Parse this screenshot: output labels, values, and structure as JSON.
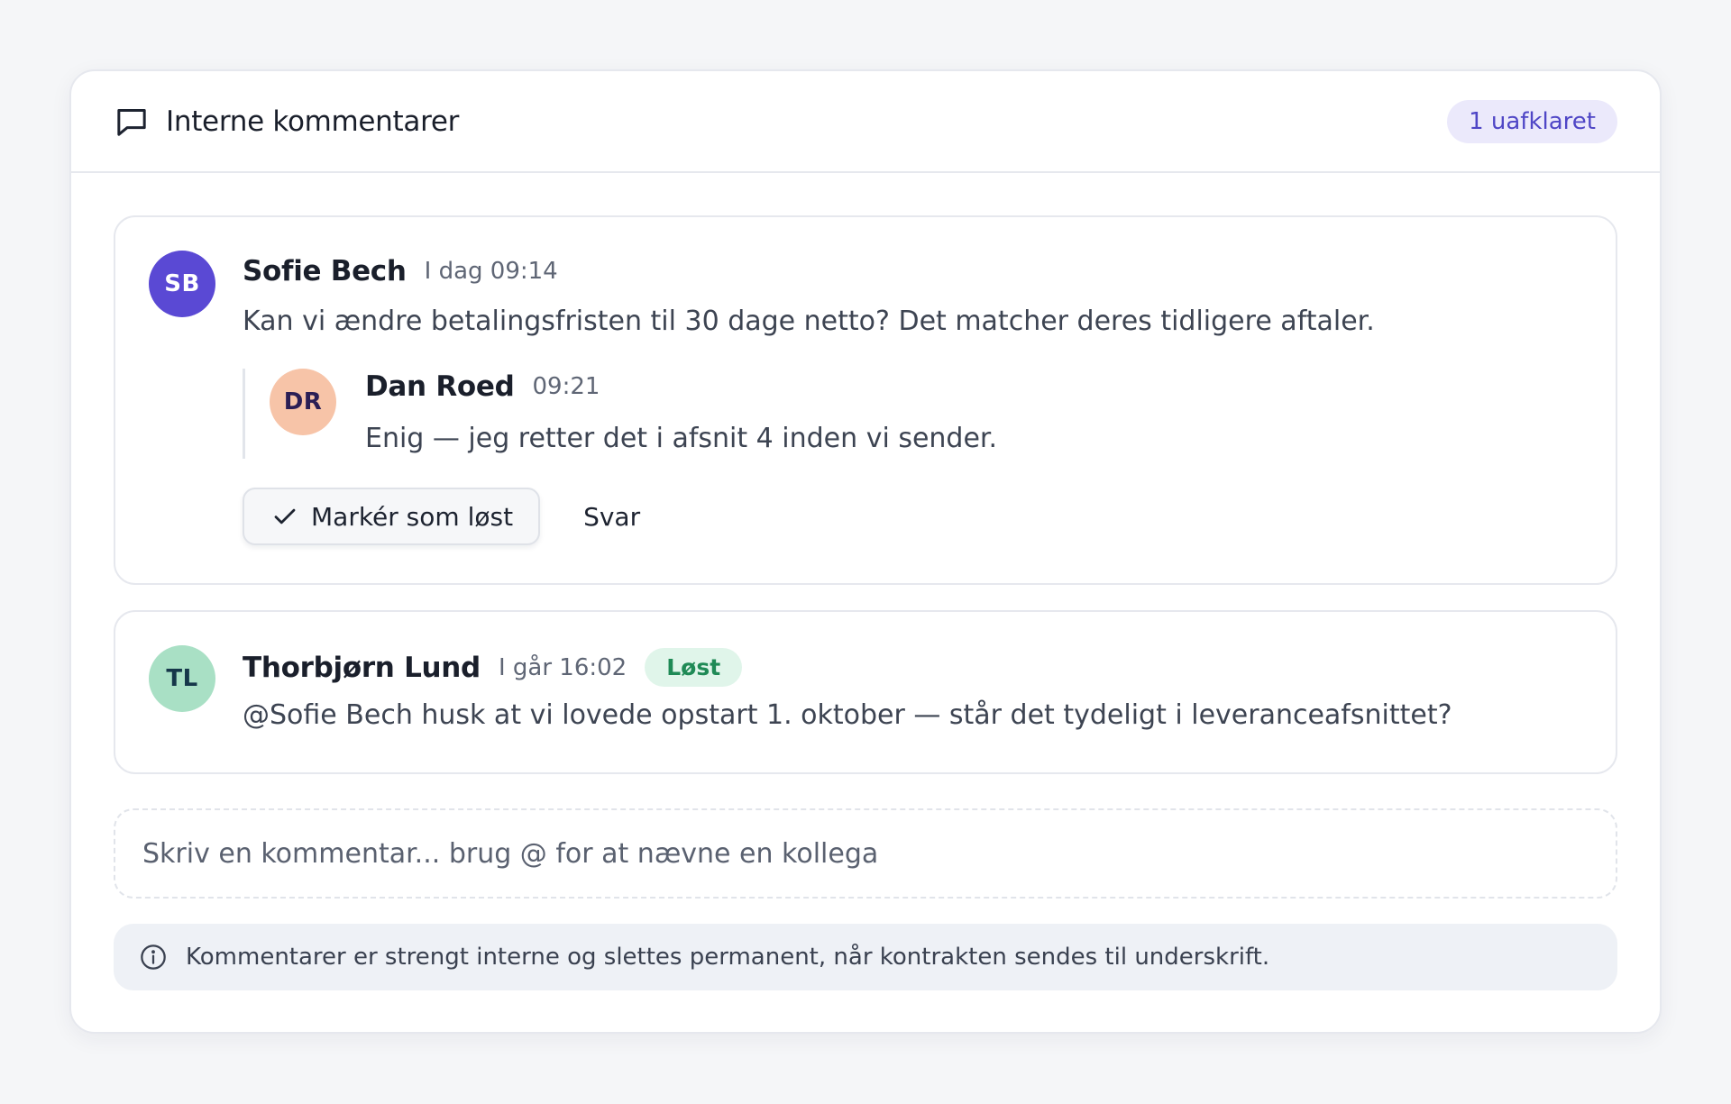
{
  "header": {
    "title": "Interne kommentarer",
    "icon": "message-square-icon",
    "unresolved_badge": "1 uafklaret"
  },
  "threads": [
    {
      "initials": "SB",
      "author": "Sofie Bech",
      "time": "I dag 09:14",
      "text": "Kan vi ændre betalingsfristen til 30 dage netto? Det matcher deres tidligere aftaler.",
      "avatar_color": "#5a49d4",
      "replies": [
        {
          "initials": "DR",
          "author": "Dan Roed",
          "time": "09:21",
          "text": "Enig — jeg retter det i afsnit 4 inden vi sender.",
          "avatar_color": "#f7c4a8"
        }
      ],
      "actions": {
        "resolve_label": "Markér som løst",
        "reply_label": "Svar"
      }
    },
    {
      "initials": "TL",
      "author": "Thorbjørn Lund",
      "time": "I går 16:02",
      "status": "Løst",
      "text": "@Sofie Bech husk at vi lovede opstart 1. oktober — står det tydeligt i leveranceafsnittet?",
      "avatar_color": "#a9e0c5"
    }
  ],
  "composer": {
    "placeholder": "Skriv en kommentar... brug @ for at nævne en kollega",
    "value": ""
  },
  "notice": {
    "icon": "info-icon",
    "text": "Kommentarer er strengt interne og slettes permanent, når kontrakten sendes til underskrift."
  },
  "colors": {
    "accent": "#4f46c6",
    "resolved": "#1f8a56",
    "border": "#e6e8ee"
  }
}
